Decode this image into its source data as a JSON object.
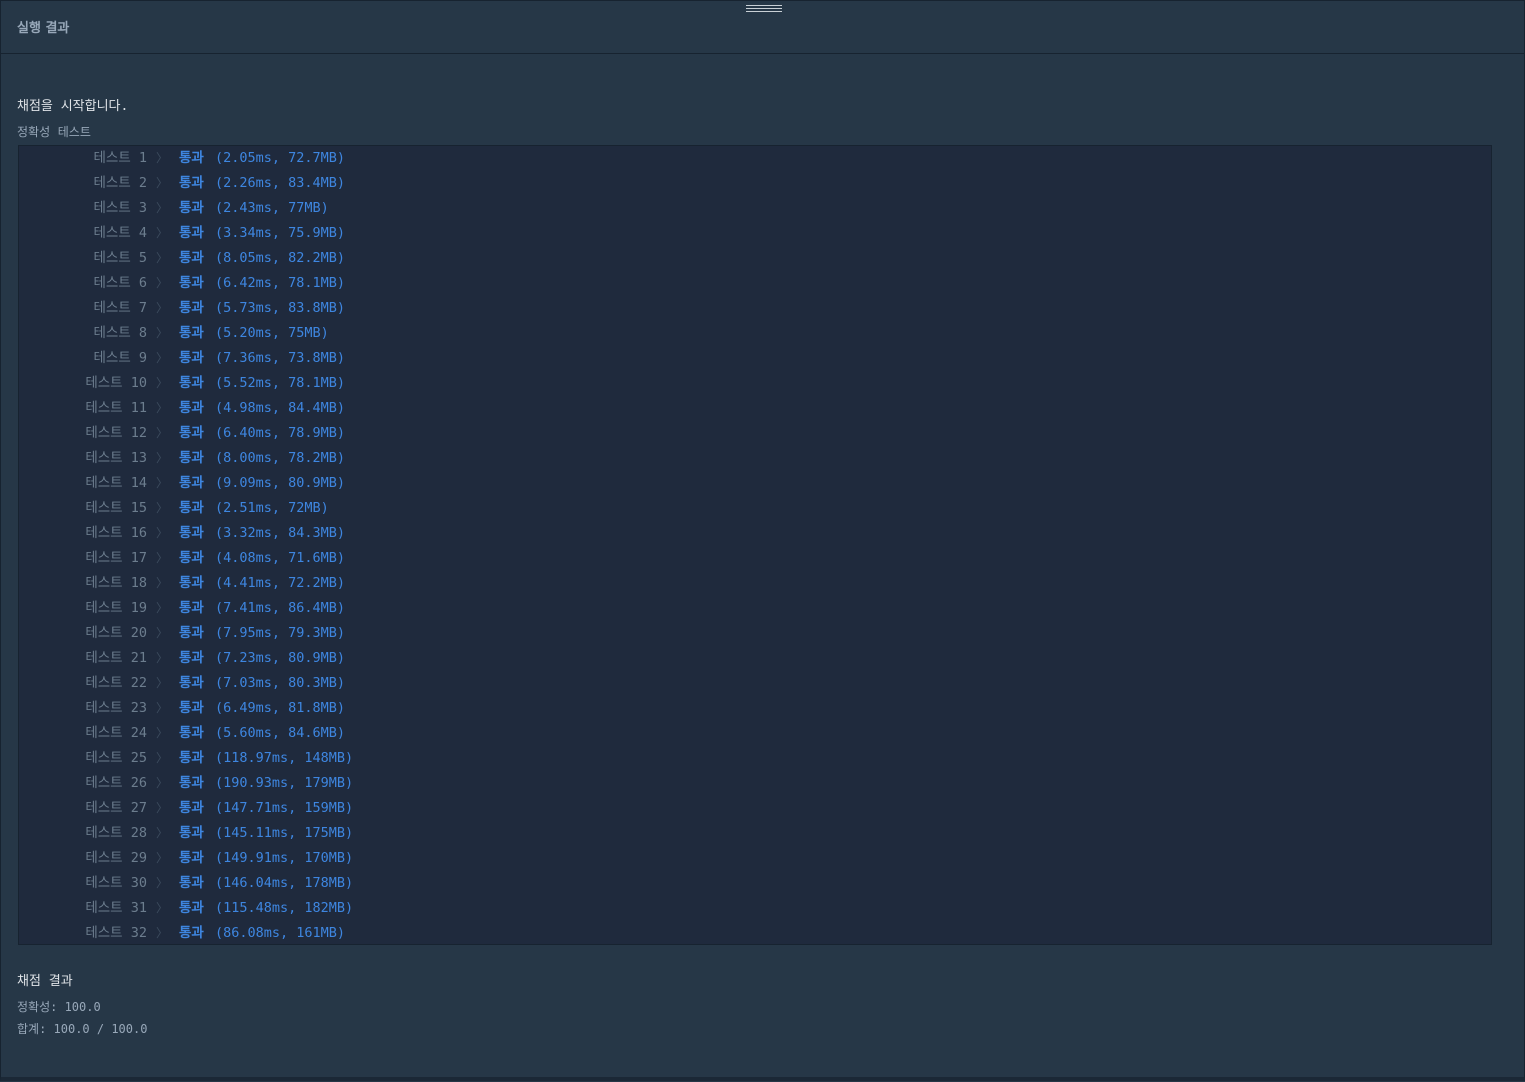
{
  "header": {
    "title": "실행 결과"
  },
  "log": {
    "start_message": "채점을 시작합니다.",
    "section_label": "정확성  테스트"
  },
  "tests": [
    {
      "label": "테스트 1",
      "result": "통과",
      "detail": "(2.05ms, 72.7MB)"
    },
    {
      "label": "테스트 2",
      "result": "통과",
      "detail": "(2.26ms, 83.4MB)"
    },
    {
      "label": "테스트 3",
      "result": "통과",
      "detail": "(2.43ms, 77MB)"
    },
    {
      "label": "테스트 4",
      "result": "통과",
      "detail": "(3.34ms, 75.9MB)"
    },
    {
      "label": "테스트 5",
      "result": "통과",
      "detail": "(8.05ms, 82.2MB)"
    },
    {
      "label": "테스트 6",
      "result": "통과",
      "detail": "(6.42ms, 78.1MB)"
    },
    {
      "label": "테스트 7",
      "result": "통과",
      "detail": "(5.73ms, 83.8MB)"
    },
    {
      "label": "테스트 8",
      "result": "통과",
      "detail": "(5.20ms, 75MB)"
    },
    {
      "label": "테스트 9",
      "result": "통과",
      "detail": "(7.36ms, 73.8MB)"
    },
    {
      "label": "테스트 10",
      "result": "통과",
      "detail": "(5.52ms, 78.1MB)"
    },
    {
      "label": "테스트 11",
      "result": "통과",
      "detail": "(4.98ms, 84.4MB)"
    },
    {
      "label": "테스트 12",
      "result": "통과",
      "detail": "(6.40ms, 78.9MB)"
    },
    {
      "label": "테스트 13",
      "result": "통과",
      "detail": "(8.00ms, 78.2MB)"
    },
    {
      "label": "테스트 14",
      "result": "통과",
      "detail": "(9.09ms, 80.9MB)"
    },
    {
      "label": "테스트 15",
      "result": "통과",
      "detail": "(2.51ms, 72MB)"
    },
    {
      "label": "테스트 16",
      "result": "통과",
      "detail": "(3.32ms, 84.3MB)"
    },
    {
      "label": "테스트 17",
      "result": "통과",
      "detail": "(4.08ms, 71.6MB)"
    },
    {
      "label": "테스트 18",
      "result": "통과",
      "detail": "(4.41ms, 72.2MB)"
    },
    {
      "label": "테스트 19",
      "result": "통과",
      "detail": "(7.41ms, 86.4MB)"
    },
    {
      "label": "테스트 20",
      "result": "통과",
      "detail": "(7.95ms, 79.3MB)"
    },
    {
      "label": "테스트 21",
      "result": "통과",
      "detail": "(7.23ms, 80.9MB)"
    },
    {
      "label": "테스트 22",
      "result": "통과",
      "detail": "(7.03ms, 80.3MB)"
    },
    {
      "label": "테스트 23",
      "result": "통과",
      "detail": "(6.49ms, 81.8MB)"
    },
    {
      "label": "테스트 24",
      "result": "통과",
      "detail": "(5.60ms, 84.6MB)"
    },
    {
      "label": "테스트 25",
      "result": "통과",
      "detail": "(118.97ms, 148MB)"
    },
    {
      "label": "테스트 26",
      "result": "통과",
      "detail": "(190.93ms, 179MB)"
    },
    {
      "label": "테스트 27",
      "result": "통과",
      "detail": "(147.71ms, 159MB)"
    },
    {
      "label": "테스트 28",
      "result": "통과",
      "detail": "(145.11ms, 175MB)"
    },
    {
      "label": "테스트 29",
      "result": "통과",
      "detail": "(149.91ms, 170MB)"
    },
    {
      "label": "테스트 30",
      "result": "통과",
      "detail": "(146.04ms, 178MB)"
    },
    {
      "label": "테스트 31",
      "result": "통과",
      "detail": "(115.48ms, 182MB)"
    },
    {
      "label": "테스트 32",
      "result": "통과",
      "detail": "(86.08ms, 161MB)"
    }
  ],
  "summary": {
    "title": "채점 결과",
    "accuracy": "정확성: 100.0",
    "total": "합계: 100.0 / 100.0"
  },
  "colors": {
    "background": "#263747",
    "panel": "#1f2a3d",
    "pass": "#3e86e0",
    "muted": "#98a8b9"
  },
  "icons": {
    "resize_handle": "drag-handle-icon",
    "row_separator": "chevron-right-icon"
  }
}
